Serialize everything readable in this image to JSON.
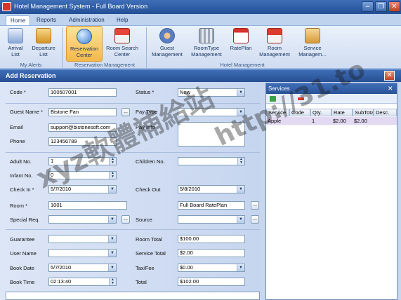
{
  "window": {
    "title": "Hotel Management System - Full Board Version"
  },
  "ribbon": {
    "tabs": [
      "Home",
      "Reports",
      "Administration",
      "Help"
    ],
    "buttons": [
      {
        "label1": "Arrival",
        "label2": "List"
      },
      {
        "label1": "Departure",
        "label2": "List"
      },
      {
        "label1": "Reservation",
        "label2": "Center"
      },
      {
        "label1": "Room Search",
        "label2": "Center"
      },
      {
        "label1": "Guest",
        "label2": "Management"
      },
      {
        "label1": "RoomType",
        "label2": "Management"
      },
      {
        "label1": "RatePlan",
        "label2": ""
      },
      {
        "label1": "Room",
        "label2": "Management"
      },
      {
        "label1": "Service",
        "label2": "Managem..."
      }
    ],
    "groups": [
      "My Alerts",
      "Reservation Management",
      "Hotel Management"
    ]
  },
  "dialog": {
    "title": "Add Reservation",
    "close": "✕",
    "labels": {
      "code": "Code *",
      "status": "Status *",
      "guest_name": "Guest Name *",
      "pay_type": "Pay Type",
      "email": "Email",
      "pay_info": "Pay Info",
      "phone": "Phone",
      "adult_no": "Adult No.",
      "children_no": "Children No.",
      "infant_no": "Infant No.",
      "check_in": "Check In *",
      "check_out": "Check Out",
      "room": "Room *",
      "special_req": "Special Req.",
      "source": "Source",
      "guarantee": "Guarantee",
      "room_total": "Room Total",
      "user_name": "User Name",
      "service_total": "Service Total",
      "book_date": "Book Date",
      "tax_fee": "Tax/Fee",
      "book_time": "Book Time",
      "total": "Total"
    },
    "values": {
      "code": "100507001",
      "status": "New",
      "guest_name": "Bistone Fan",
      "pay_type": "",
      "email": "support@bistonesoft.com",
      "phone": "123456789",
      "adult_no": "1",
      "children_no": "",
      "infant_no": "0",
      "check_in": "5/7/2010",
      "check_out": "5/8/2010",
      "room": "1001",
      "rate_plan": "Full Board RatePlan",
      "special_req": "",
      "source": "",
      "guarantee": "",
      "room_total": "$100.00",
      "user_name": "",
      "service_total": "$2.00",
      "book_date": "5/7/2010",
      "tax_fee": "$0.00",
      "book_time": "02:13:40",
      "total": "$102.00"
    },
    "ellipsis": "..."
  },
  "services": {
    "title": "Services",
    "close": "✕",
    "columns": [
      "Service",
      "Code",
      "Qty.",
      "Rate",
      "SubTotal",
      "Desc."
    ],
    "rows": [
      {
        "service": "Apple",
        "code": "",
        "qty": "1",
        "rate": "$2.00",
        "subtotal": "$2.00",
        "desc": ""
      }
    ]
  },
  "watermark": {
    "line1": "xyz軟體補給站",
    "line2": "http://31.to"
  }
}
